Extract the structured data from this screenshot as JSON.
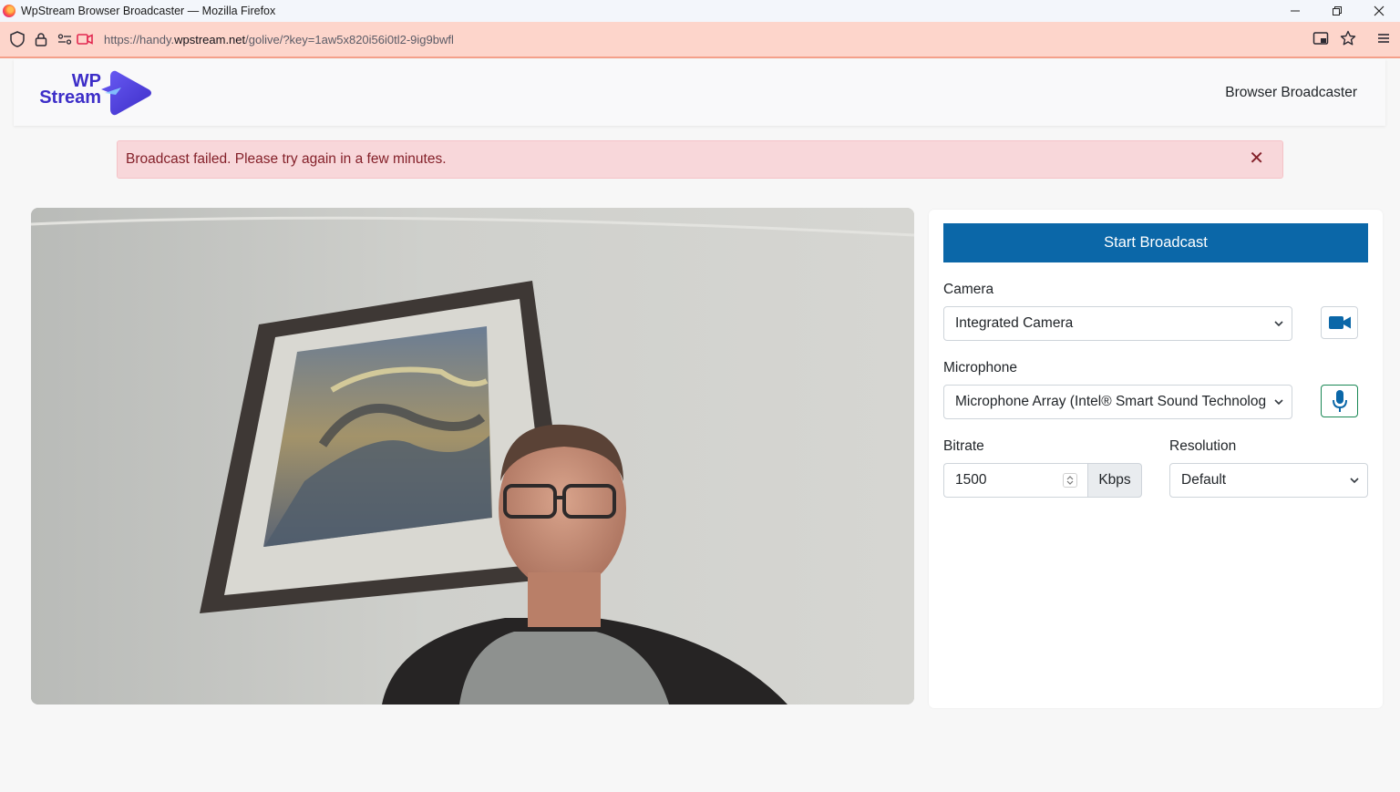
{
  "browser": {
    "title": "WpStream Browser Broadcaster — Mozilla Firefox",
    "url_prefix": "https://handy.",
    "url_host": "wpstream.net",
    "url_path": "/golive/?key=1aw5x820i56i0tl2-9ig9bwfl"
  },
  "header": {
    "logo_line1": "WP",
    "logo_line2": "Stream",
    "nav_link": "Browser Broadcaster",
    "brand_color": "#3d2ec8"
  },
  "alert": {
    "message": "Broadcast failed. Please try again in a few minutes.",
    "close_symbol": "✕"
  },
  "controls": {
    "start_label": "Start Broadcast",
    "camera_label": "Camera",
    "camera_value": "Integrated Camera",
    "microphone_label": "Microphone",
    "microphone_value": "Microphone Array (Intel® Smart Sound Technolog",
    "bitrate_label": "Bitrate",
    "bitrate_value": "1500",
    "bitrate_unit": "Kbps",
    "resolution_label": "Resolution",
    "resolution_value": "Default",
    "accent_color": "#0b67a8"
  }
}
